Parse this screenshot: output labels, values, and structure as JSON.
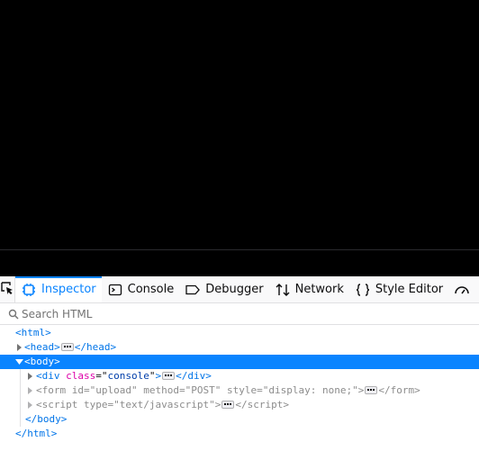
{
  "toolbar": {
    "tabs": [
      {
        "label": "Inspector",
        "icon": "inspector-icon",
        "active": true
      },
      {
        "label": "Console",
        "icon": "console-icon",
        "active": false
      },
      {
        "label": "Debugger",
        "icon": "debugger-icon",
        "active": false
      },
      {
        "label": "Network",
        "icon": "network-icon",
        "active": false
      },
      {
        "label": "Style Editor",
        "icon": "style-editor-icon",
        "active": false
      }
    ]
  },
  "search": {
    "placeholder": "Search HTML"
  },
  "tree": {
    "html_open": "html",
    "head": "head",
    "body": "body",
    "div": {
      "tag": "div",
      "attr": "class",
      "value": "console"
    },
    "form": {
      "tag": "form",
      "attrs": [
        {
          "name": "id",
          "value": "upload"
        },
        {
          "name": "method",
          "value": "POST"
        },
        {
          "name": "style",
          "value": "display: none;"
        }
      ]
    },
    "script": {
      "tag": "script",
      "attr": "type",
      "value": "text/javascript"
    }
  },
  "colors": {
    "accent": "#0a84ff",
    "tag": "#0074e8",
    "attr_name": "#dd00a9",
    "attr_value": "#003eaa",
    "page_background": "#000000"
  }
}
